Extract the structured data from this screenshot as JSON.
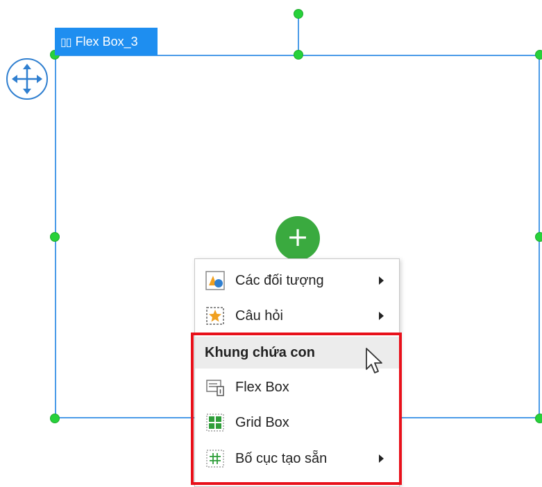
{
  "selection": {
    "tag_label": "Flex Box_3",
    "tag_icon": "flexbox-icon",
    "move_icon": "move-arrows-icon",
    "add_icon": "plus-icon",
    "accent_color": "#1e8ef0",
    "handle_color": "#27d13a",
    "add_button_color": "#3aaa3f",
    "highlight_color": "#e8101a"
  },
  "context_menu": {
    "items": [
      {
        "label": "Các đối tượng",
        "icon": "objects-icon",
        "has_submenu": true
      },
      {
        "label": "Câu hỏi",
        "icon": "question-star-icon",
        "has_submenu": true
      }
    ],
    "section_header": "Khung chứa con",
    "section_items": [
      {
        "label": "Flex Box",
        "icon": "flexbox-icon",
        "has_submenu": false
      },
      {
        "label": "Grid Box",
        "icon": "gridbox-icon",
        "has_submenu": false
      },
      {
        "label": "Bố cục tạo sẵn",
        "icon": "preset-layout-icon",
        "has_submenu": true
      }
    ]
  }
}
